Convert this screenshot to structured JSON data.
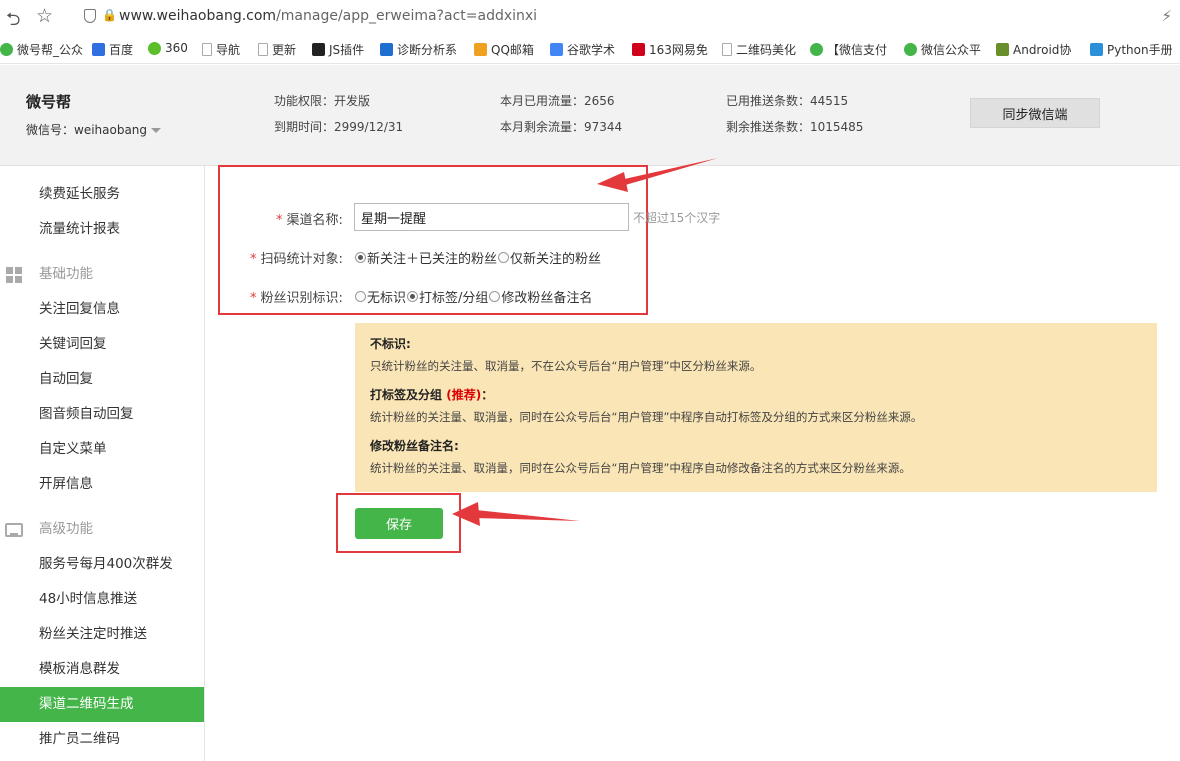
{
  "browser": {
    "url_host": "www.weihaobang.com",
    "url_path": "/manage/app_erweima?act=addxinxi"
  },
  "bookmarks": [
    {
      "label": "微号帮_公众",
      "icon": "app-icon",
      "color": "#44b549"
    },
    {
      "label": "百度",
      "icon": "paw-icon",
      "color": "#2f6fe0"
    },
    {
      "label": "360",
      "icon": "globe-icon",
      "color": "#5bbf2a"
    },
    {
      "label": "导航",
      "icon": "page-icon",
      "color": "#aaaaaa"
    },
    {
      "label": "更新",
      "icon": "page-icon",
      "color": "#aaaaaa"
    },
    {
      "label": "JS插件",
      "icon": "js-icon",
      "color": "#222222"
    },
    {
      "label": "诊断分析系",
      "icon": "x-icon",
      "color": "#1f6fd0"
    },
    {
      "label": "QQ邮箱",
      "icon": "mail-icon",
      "color": "#f0a020"
    },
    {
      "label": "谷歌学术",
      "icon": "google-icon",
      "color": "#4285f4"
    },
    {
      "label": "163网易免",
      "icon": "netease-icon",
      "color": "#d0021b"
    },
    {
      "label": "二维码美化",
      "icon": "page-icon",
      "color": "#aaaaaa"
    },
    {
      "label": "【微信支付",
      "icon": "wechat-icon",
      "color": "#44b549"
    },
    {
      "label": "微信公众平",
      "icon": "wechat-icon",
      "color": "#44b549"
    },
    {
      "label": "Android协",
      "icon": "android-icon",
      "color": "#6a8f2a"
    },
    {
      "label": "Python手册",
      "icon": "python-icon",
      "color": "#2b90d9"
    }
  ],
  "header": {
    "brand": "微号帮",
    "wechat_id": "微信号：weihaobang",
    "stats": [
      "功能权限：开发版",
      "到期时间：2999/12/31",
      "本月已用流量：2656",
      "本月剩余流量：97344",
      "已用推送条数：44515",
      "剩余推送条数：1015485"
    ],
    "sync_button": "同步微信端"
  },
  "sidebar": {
    "items_top": [
      "续费延长服务",
      "流量统计报表"
    ],
    "group_basic": "基础功能",
    "items_basic": [
      "关注回复信息",
      "关键词回复",
      "自动回复",
      "图音频自动回复",
      "自定义菜单",
      "开屏信息"
    ],
    "group_advanced": "高级功能",
    "items_advanced": [
      "服务号每月400次群发",
      "48小时信息推送",
      "粉丝关注定时推送",
      "模板消息群发",
      "渠道二维码生成",
      "推广员二维码"
    ],
    "active": "渠道二维码生成"
  },
  "form": {
    "required_mark": "*",
    "channel_name_label": "渠道名称:",
    "channel_name_value": "星期一提醒",
    "channel_name_hint": "不超过15个汉字",
    "scan_target_label": "扫码统计对象:",
    "scan_target_options": [
      "新关注＋已关注的粉丝",
      "仅新关注的粉丝"
    ],
    "scan_target_selected": 0,
    "fan_id_label": "粉丝识别标识:",
    "fan_id_options": [
      "无标识",
      "打标签/分组",
      "修改粉丝备注名"
    ],
    "fan_id_selected": 1
  },
  "info": {
    "title1": "不标识:",
    "text1": "只统计粉丝的关注量、取消量，不在公众号后台“用户管理”中区分粉丝来源。",
    "title2": "打标签及分组",
    "title2_rec": "(推荐)",
    "title2_suffix": "：",
    "text2": "统计粉丝的关注量、取消量，同时在公众号后台“用户管理”中程序自动打标签及分组的方式来区分粉丝来源。",
    "title3": "修改粉丝备注名:",
    "text3": "统计粉丝的关注量、取消量，同时在公众号后台“用户管理”中程序自动修改备注名的方式来区分粉丝来源。"
  },
  "save_button": "保存",
  "colors": {
    "accent_green": "#44b549",
    "annotation_red": "#e4393c",
    "info_bg": "#fae5b6"
  }
}
